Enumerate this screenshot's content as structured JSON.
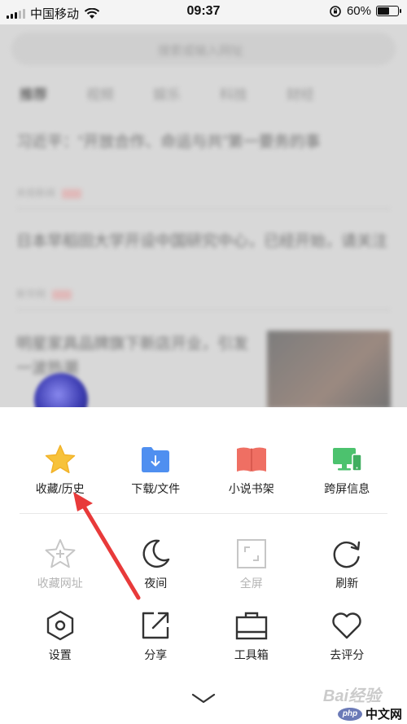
{
  "status_bar": {
    "carrier": "中国移动",
    "time": "09:37",
    "battery": "60%",
    "battery_level": 0.6
  },
  "background": {
    "search_placeholder": "搜索或输入网址",
    "tabs": [
      "推荐",
      "视频",
      "娱乐",
      "科技",
      "财经"
    ],
    "news": [
      {
        "title": "习近平：“开放合作、命运与共”第一要务的事",
        "source": "央视新闻"
      },
      {
        "title": "日本早稻田大学开设中国研究中心，已经开始，请关注",
        "source": "新华网"
      },
      {
        "title": "明星家具品牌旗下新店开业，引发一波热潮",
        "source": ""
      }
    ]
  },
  "menu": {
    "row1": [
      {
        "label": "收藏/历史",
        "icon": "star-icon",
        "color": "#f7c23a"
      },
      {
        "label": "下载/文件",
        "icon": "download-folder-icon",
        "color": "#4f8ff0"
      },
      {
        "label": "小说书架",
        "icon": "book-icon",
        "color": "#ef6f63"
      },
      {
        "label": "跨屏信息",
        "icon": "multi-screen-icon",
        "color": "#4cc26e"
      }
    ],
    "row2": [
      {
        "label": "收藏网址",
        "icon": "add-star-icon",
        "disabled": true
      },
      {
        "label": "夜间",
        "icon": "moon-icon"
      },
      {
        "label": "全屏",
        "icon": "fullscreen-icon",
        "disabled": true
      },
      {
        "label": "刷新",
        "icon": "refresh-icon"
      }
    ],
    "row3": [
      {
        "label": "设置",
        "icon": "settings-icon"
      },
      {
        "label": "分享",
        "icon": "share-icon"
      },
      {
        "label": "工具箱",
        "icon": "toolbox-icon"
      },
      {
        "label": "去评分",
        "icon": "heart-icon"
      }
    ]
  },
  "annotation": {
    "arrow_color": "#e83a3a"
  },
  "watermark": {
    "baidu": "Bai经验",
    "php_logo": "php",
    "php_text": "中文网"
  }
}
